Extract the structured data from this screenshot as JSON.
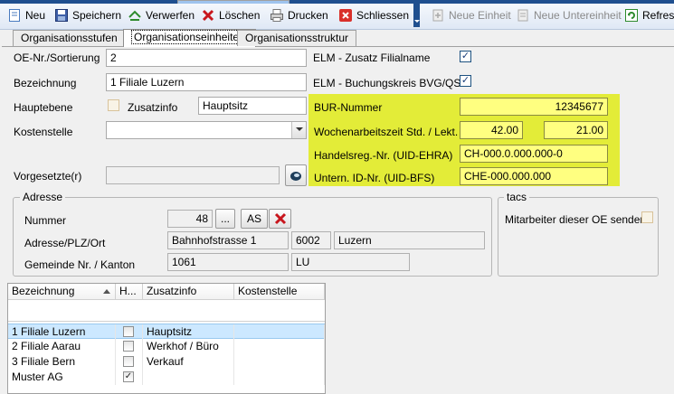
{
  "toolbar": {
    "new": "Neu",
    "save": "Speichern",
    "discard": "Verwerfen",
    "delete": "Löschen",
    "print": "Drucken",
    "close": "Schliessen",
    "new_unit": "Neue Einheit",
    "new_subunit": "Neue Untereinheit",
    "refresh": "Refresh"
  },
  "tabs": [
    "Organisationsstufen",
    "Organisationseinheiten",
    "Organisationsstruktur"
  ],
  "form": {
    "oe_nr_label": "OE-Nr./Sortierung",
    "oe_nr_value": "2",
    "bezeichnung_label": "Bezeichnung",
    "bezeichnung_value": "1 Filiale Luzern",
    "hauptebene_label": "Hauptebene",
    "zusatzinfo_label": "Zusatzinfo",
    "zusatzinfo_value": "Hauptsitz",
    "kostenstelle_label": "Kostenstelle",
    "kostenstelle_value": "",
    "vorgesetzte_label": "Vorgesetzte(r)",
    "vorgesetzte_value": "",
    "elm_filialname_label": "ELM - Zusatz Filialname",
    "elm_buchungskreis_label": "ELM - Buchungskreis BVG/QST",
    "bur_label": "BUR-Nummer",
    "bur_value": "12345677",
    "wochen_label": "Wochenarbeitszeit Std. / Lekt.",
    "wochen_std": "42.00",
    "wochen_lekt": "21.00",
    "handelsreg_label": "Handelsreg.-Nr. (UID-EHRA)",
    "handelsreg_value": "CH-000.0.000.000-0",
    "untern_label": "Untern. ID-Nr. (UID-BFS)",
    "untern_value": "CHE-000.000.000"
  },
  "adresse": {
    "title": "Adresse",
    "nummer_label": "Nummer",
    "nummer_value": "48",
    "browse_label": "...",
    "as_label": "AS",
    "plzort_label": "Adresse/PLZ/Ort",
    "strasse": "Bahnhofstrasse 1",
    "plz": "6002",
    "ort": "Luzern",
    "gemeinde_label": "Gemeinde Nr. / Kanton",
    "gemeinde_nr": "1061",
    "kanton": "LU"
  },
  "tacs": {
    "title": "tacs",
    "send_label": "Mitarbeiter dieser OE senden"
  },
  "grid": {
    "headers": [
      "Bezeichnung",
      "H...",
      "Zusatzinfo",
      "Kostenstelle"
    ],
    "rows": [
      {
        "bez": "1 Filiale Luzern",
        "h": false,
        "info": "Hauptsitz",
        "kst": ""
      },
      {
        "bez": "2 Filiale Aarau",
        "h": false,
        "info": "Werkhof / Büro",
        "kst": ""
      },
      {
        "bez": "3 Filiale Bern",
        "h": false,
        "info": "Verkauf",
        "kst": ""
      },
      {
        "bez": "Muster AG",
        "h": true,
        "info": "",
        "kst": ""
      }
    ]
  },
  "colors": {
    "highlight": "#e3ec38",
    "field_yellow": "#ffff80",
    "selection": "#cce8ff"
  }
}
